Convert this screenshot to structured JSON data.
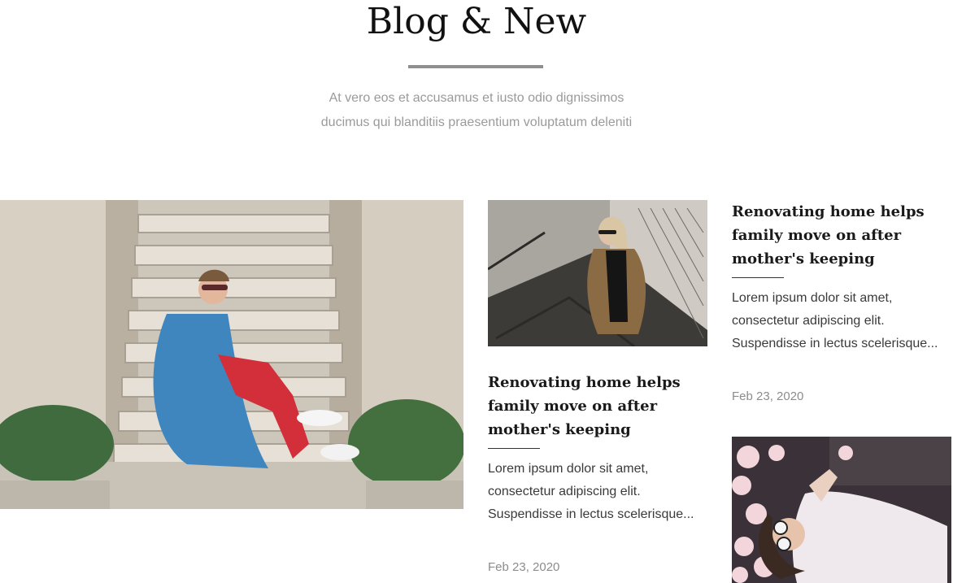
{
  "section": {
    "title": "Blog & New",
    "subtitle_line1": "At vero eos et accusamus et iusto odio dignissimos",
    "subtitle_line2": "ducimus qui blanditiis praesentium voluptatum deleniti"
  },
  "posts": [
    {
      "title": "Renovating home helps family move on after mother's keeping",
      "excerpt": "Lorem ipsum dolor sit amet, consectetur adipiscing elit. Suspendisse in lectus scelerisque...",
      "date": "Feb 23, 2020"
    },
    {
      "title": "Renovating home helps family move on after mother's keeping",
      "excerpt": "Lorem ipsum dolor sit amet, consectetur adipiscing elit. Suspendisse in lectus scelerisque...",
      "date": "Feb 23, 2020"
    }
  ],
  "colors": {
    "heading": "#111111",
    "rule": "#8f8f8f",
    "subtitle": "#9a9a9a",
    "body_text": "#3a3a3a",
    "date": "#8c8c8c"
  }
}
